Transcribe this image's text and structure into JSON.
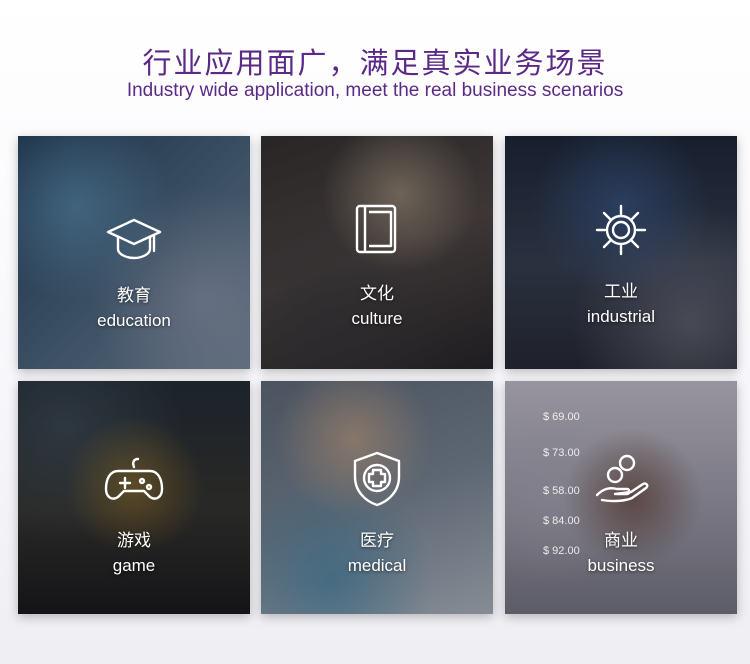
{
  "header": {
    "title_cn": "行业应用面广，满足真实业务场景",
    "title_en": "Industry wide application, meet the real business scenarios"
  },
  "tiles": [
    {
      "cn": "教育",
      "en": "education",
      "icon": "graduation-cap-icon"
    },
    {
      "cn": "文化",
      "en": "culture",
      "icon": "book-icon"
    },
    {
      "cn": "工业",
      "en": "industrial",
      "icon": "gear-icon"
    },
    {
      "cn": "游戏",
      "en": "game",
      "icon": "gamepad-icon"
    },
    {
      "cn": "医疗",
      "en": "medical",
      "icon": "medical-shield-icon"
    },
    {
      "cn": "商业",
      "en": "business",
      "icon": "coin-hand-icon"
    }
  ],
  "business_prices": [
    "$ 69.00",
    "$ 73.00",
    "$ 58.00",
    "$ 84.00",
    "$ 92.00"
  ],
  "colors": {
    "title": "#5b2a86"
  }
}
